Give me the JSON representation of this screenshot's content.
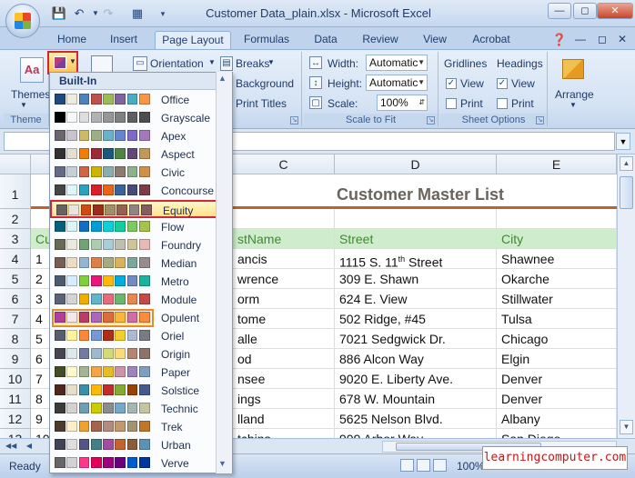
{
  "window": {
    "title": "Customer Data_plain.xlsx - Microsoft Excel"
  },
  "tabs": [
    "Home",
    "Insert",
    "Page Layout",
    "Formulas",
    "Data",
    "Review",
    "View",
    "Acrobat"
  ],
  "ribbon": {
    "themes_label": "Themes",
    "themes_group": "Theme",
    "orientation": "Orientation",
    "breaks": "Breaks",
    "background": "Background",
    "print_titles": "Print Titles",
    "width_label": "Width:",
    "width_value": "Automatic",
    "height_label": "Height:",
    "height_value": "Automatic",
    "scale_label": "Scale:",
    "scale_value": "100%",
    "scale_group": "Scale to Fit",
    "gridlines": "Gridlines",
    "headings": "Headings",
    "view": "View",
    "print": "Print",
    "sheet_group": "Sheet Options",
    "arrange": "Arrange"
  },
  "dropdown": {
    "header": "Built-In",
    "items": [
      {
        "name": "Office",
        "colors": [
          "#1f497d",
          "#eeece1",
          "#4f81bd",
          "#c0504d",
          "#9bbb59",
          "#8064a2",
          "#4bacc6",
          "#f79646"
        ]
      },
      {
        "name": "Grayscale",
        "colors": [
          "#000000",
          "#f8f8f8",
          "#dddddd",
          "#b2b2b2",
          "#969696",
          "#808080",
          "#5f5f5f",
          "#4d4d4d"
        ]
      },
      {
        "name": "Apex",
        "colors": [
          "#69676d",
          "#c9c2d1",
          "#ceb966",
          "#9cb084",
          "#6bb1c9",
          "#6585cf",
          "#7e6bc9",
          "#a379bb"
        ]
      },
      {
        "name": "Aspect",
        "colors": [
          "#323232",
          "#e3ded1",
          "#f07f09",
          "#9f2936",
          "#1b587c",
          "#4e8542",
          "#604878",
          "#c19859"
        ]
      },
      {
        "name": "Civic",
        "colors": [
          "#646b86",
          "#c5d1d7",
          "#d16349",
          "#ccb400",
          "#8cadae",
          "#8c7b70",
          "#8fb08c",
          "#d19049"
        ]
      },
      {
        "name": "Concourse",
        "colors": [
          "#464646",
          "#def5fa",
          "#2da2bf",
          "#da1f28",
          "#eb641b",
          "#39639d",
          "#474b78",
          "#7d3c4a"
        ]
      },
      {
        "name": "Equity",
        "colors": [
          "#696464",
          "#e9e5dc",
          "#d34817",
          "#9b2d1f",
          "#a28e6a",
          "#956251",
          "#918485",
          "#855d5d"
        ]
      },
      {
        "name": "Flow",
        "colors": [
          "#04617b",
          "#dbf5f9",
          "#0f6fc6",
          "#009dd9",
          "#0bd0d9",
          "#10cf9b",
          "#7cca62",
          "#a5c249"
        ]
      },
      {
        "name": "Foundry",
        "colors": [
          "#676a55",
          "#eaebde",
          "#72a376",
          "#b0ccb0",
          "#a8cdd7",
          "#c0beaf",
          "#cec597",
          "#e8b7b7"
        ]
      },
      {
        "name": "Median",
        "colors": [
          "#775f55",
          "#ebddc3",
          "#94b6d2",
          "#dd8047",
          "#a5ab81",
          "#d8b25c",
          "#7ba79d",
          "#968c8c"
        ]
      },
      {
        "name": "Metro",
        "colors": [
          "#4e5b6f",
          "#d6ecff",
          "#7fd13b",
          "#ea157a",
          "#feb80a",
          "#00addc",
          "#738ac8",
          "#1ab39f"
        ]
      },
      {
        "name": "Module",
        "colors": [
          "#5a6378",
          "#d4d4d4",
          "#f0ad00",
          "#60b5cc",
          "#e66c7d",
          "#6bb76d",
          "#e88651",
          "#c64847"
        ]
      },
      {
        "name": "Opulent",
        "colors": [
          "#b13f9a",
          "#f4e7ed",
          "#b83d68",
          "#ac66bb",
          "#de6c36",
          "#f9b639",
          "#cf6da4",
          "#fa8d3d"
        ]
      },
      {
        "name": "Oriel",
        "colors": [
          "#575f6d",
          "#fff39d",
          "#fe8637",
          "#7598d9",
          "#b32c16",
          "#f5cd2d",
          "#aebad5",
          "#777c84"
        ]
      },
      {
        "name": "Origin",
        "colors": [
          "#464653",
          "#dde9ec",
          "#727ca3",
          "#9fb8cd",
          "#d2da7a",
          "#fada7a",
          "#b88472",
          "#8e736a"
        ]
      },
      {
        "name": "Paper",
        "colors": [
          "#444d26",
          "#fefac9",
          "#a5b592",
          "#f3a447",
          "#e7bc29",
          "#d092a7",
          "#9c85c0",
          "#809ec2"
        ]
      },
      {
        "name": "Solstice",
        "colors": [
          "#4f271c",
          "#e7dec9",
          "#3891a7",
          "#feb80a",
          "#c32d2e",
          "#84aa33",
          "#964305",
          "#475a8d"
        ]
      },
      {
        "name": "Technic",
        "colors": [
          "#3b3b3b",
          "#d4d2d0",
          "#6ea0b0",
          "#cccc00",
          "#8c8c8c",
          "#73a8c8",
          "#a4b8b0",
          "#c4c4a2"
        ]
      },
      {
        "name": "Trek",
        "colors": [
          "#4e3b30",
          "#fbeec9",
          "#f0a22e",
          "#a5644e",
          "#b58b80",
          "#c3986d",
          "#a19574",
          "#c17529"
        ]
      },
      {
        "name": "Urban",
        "colors": [
          "#424456",
          "#dedede",
          "#53548a",
          "#438086",
          "#a04da3",
          "#c4652d",
          "#8b5d3d",
          "#5c92b5"
        ]
      },
      {
        "name": "Verve",
        "colors": [
          "#666666",
          "#d2d2d2",
          "#ff388c",
          "#e40059",
          "#9c007f",
          "#68007f",
          "#005bd3",
          "#00349e"
        ]
      }
    ]
  },
  "grid": {
    "columns": [
      "C",
      "D",
      "E"
    ],
    "rows": [
      "1",
      "2",
      "3",
      "4",
      "5",
      "6",
      "7",
      "8",
      "9",
      "10",
      "11",
      "12",
      "13"
    ],
    "title": "Customer Master List",
    "header_row": {
      "b": "Cu",
      "c": "stName",
      "d": "Street",
      "e": "City"
    },
    "data": [
      {
        "b": "1",
        "c": "ancis",
        "d": "1115 S. 11",
        "d_sup": "th",
        "d_tail": " Street",
        "e": "Shawnee"
      },
      {
        "b": "2",
        "c": "wrence",
        "d": "309 E. Shawn",
        "e": "Okarche"
      },
      {
        "b": "3",
        "c": "orm",
        "d": "624 E. View",
        "e": "Stillwater"
      },
      {
        "b": "4",
        "c": "tome",
        "d": "502 Ridge, #45",
        "e": "Tulsa"
      },
      {
        "b": "5",
        "c": "alle",
        "d": "7021 Sedgwick Dr.",
        "e": "Chicago"
      },
      {
        "b": "6",
        "c": "od",
        "d": "886 Alcon Way",
        "e": "Elgin"
      },
      {
        "b": "7",
        "c": "nsee",
        "d": "9020 E. Liberty Ave.",
        "e": "Denver"
      },
      {
        "b": "8",
        "c": "ings",
        "d": "678 W. Mountain",
        "e": "Denver"
      },
      {
        "b": "9",
        "c": "lland",
        "d": "5625 Nelson Blvd.",
        "e": "Albany"
      },
      {
        "b": "10",
        "c": "tchins",
        "d": "909 Arbor Way",
        "e": "San Diego"
      }
    ]
  },
  "status": {
    "ready": "Ready",
    "zoom": "100%"
  },
  "watermark": "learningcomputer.com"
}
